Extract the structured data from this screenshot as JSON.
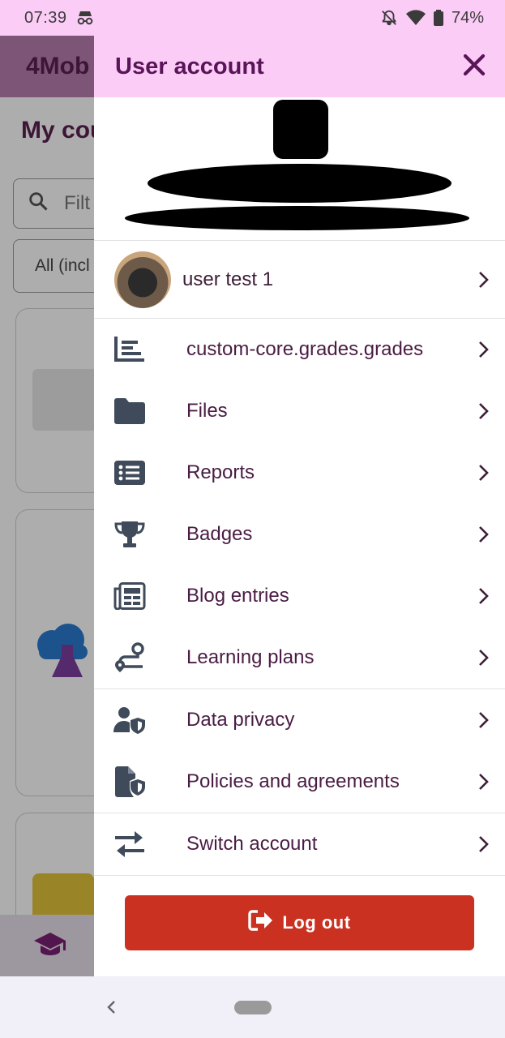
{
  "status_bar": {
    "time": "07:39",
    "battery": "74%"
  },
  "background": {
    "app_title": "4Mob",
    "page_title": "My cou",
    "search_placeholder": "Filt",
    "filter_value": "All (incl"
  },
  "drawer": {
    "title": "User account",
    "user": {
      "name": "user test 1"
    },
    "menu": [
      {
        "label": "custom-core.grades.grades",
        "icon": "grades-icon"
      },
      {
        "label": "Files",
        "icon": "folder-icon"
      },
      {
        "label": "Reports",
        "icon": "list-icon"
      },
      {
        "label": "Badges",
        "icon": "trophy-icon"
      },
      {
        "label": "Blog entries",
        "icon": "newspaper-icon"
      },
      {
        "label": "Learning plans",
        "icon": "route-icon"
      }
    ],
    "privacy_menu": [
      {
        "label": "Data privacy",
        "icon": "user-shield-icon"
      },
      {
        "label": "Policies and agreements",
        "icon": "file-shield-icon"
      }
    ],
    "switch_account": {
      "label": "Switch account",
      "icon": "swap-icon"
    },
    "logout": {
      "label": "Log out",
      "icon": "logout-icon"
    }
  },
  "colors": {
    "accent": "#fbcdf6",
    "title_text": "#5a1458",
    "logout_bg": "#ca3120"
  }
}
